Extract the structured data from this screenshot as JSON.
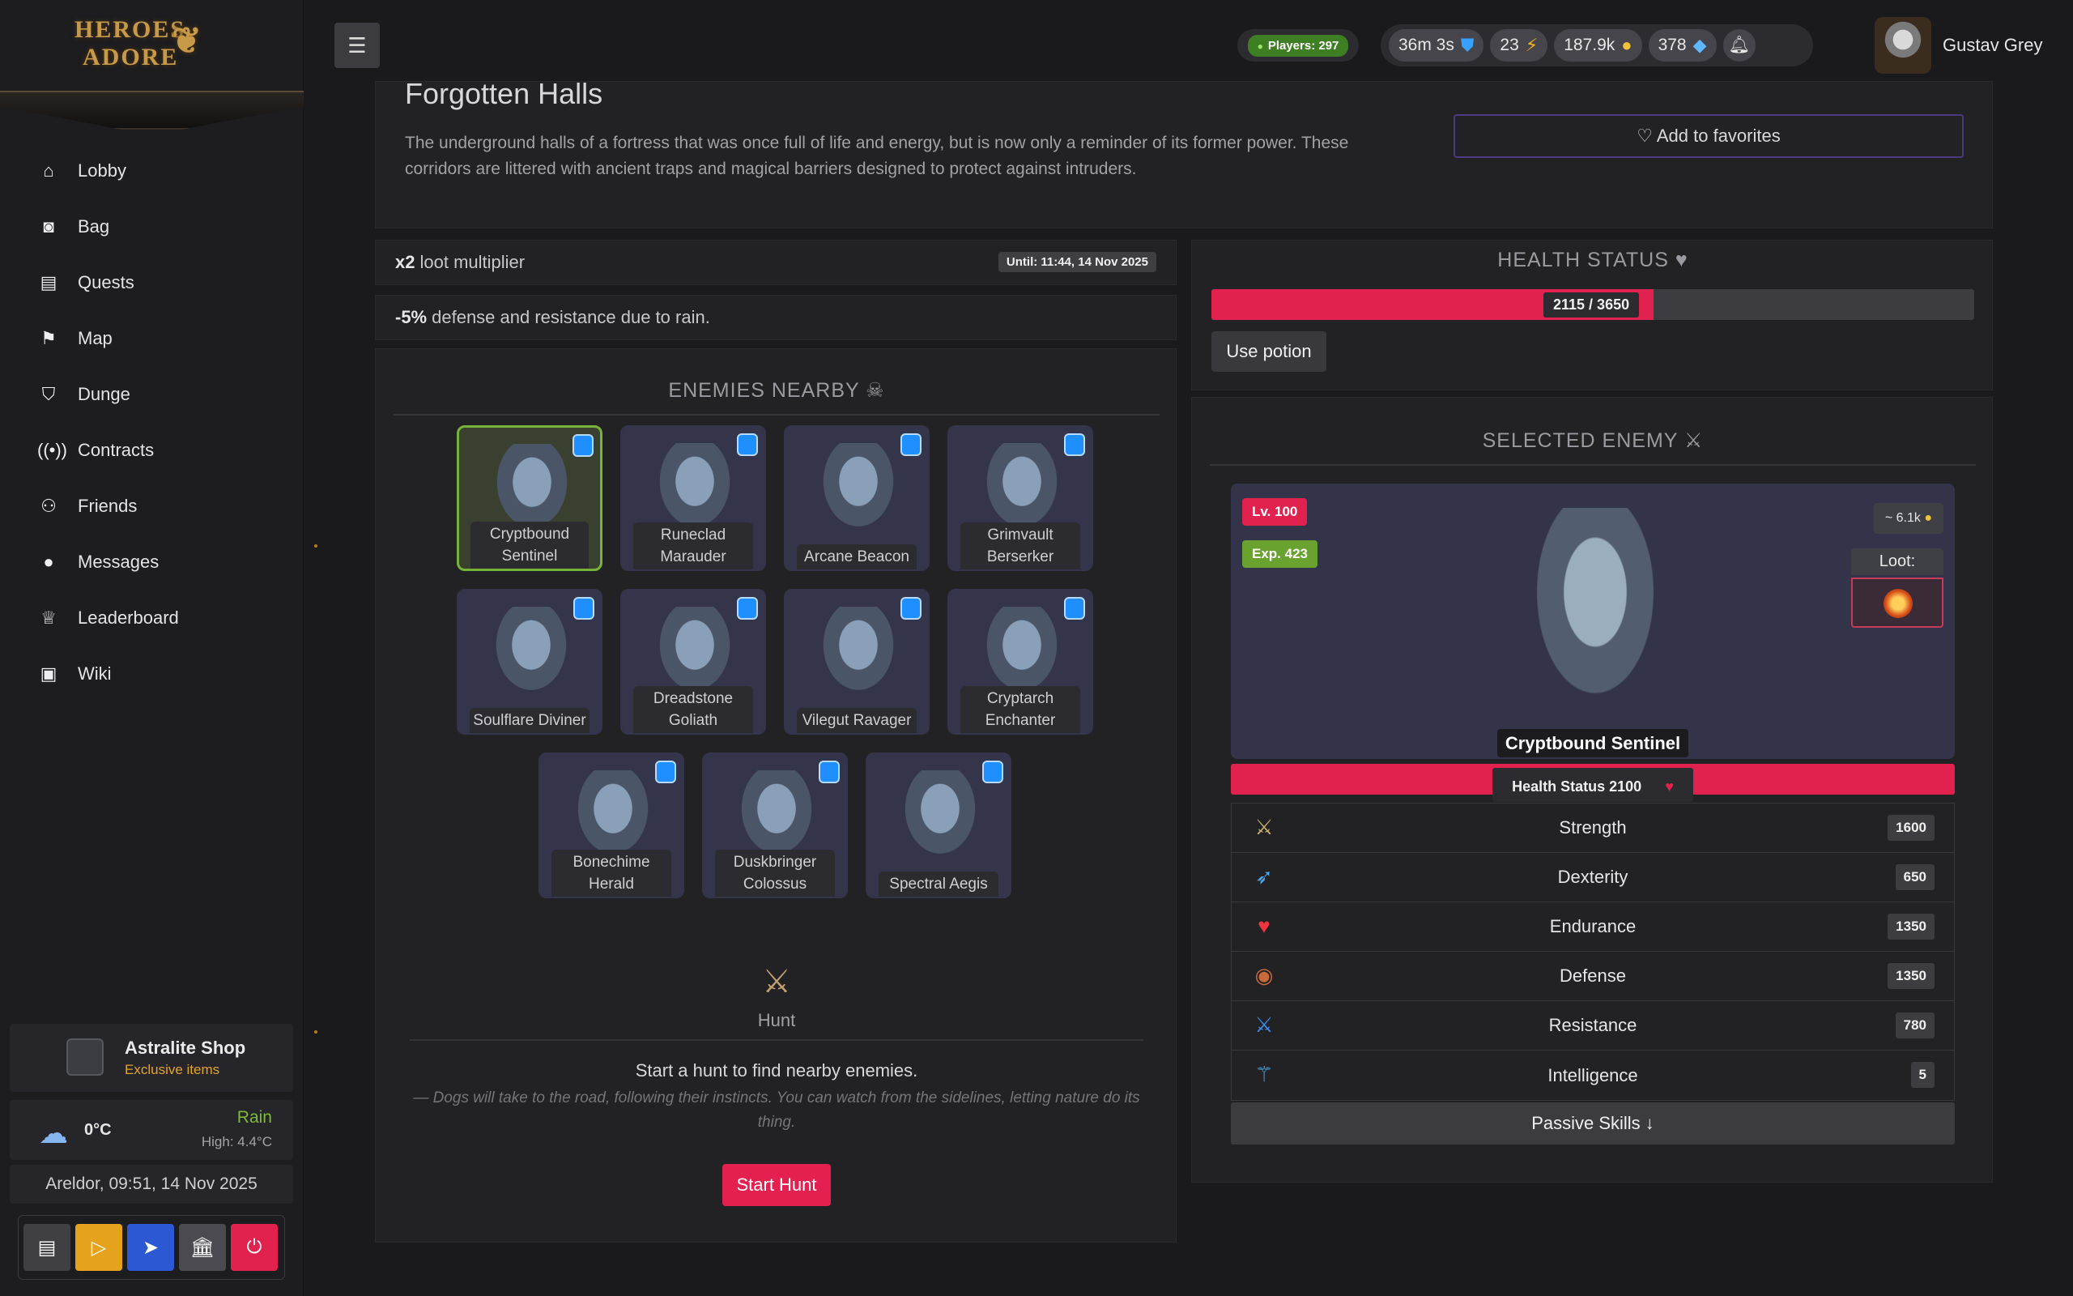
{
  "app": {
    "logo_text_1": "HEROES",
    "logo_text_2": "ADORE",
    "accent": "#e2224e"
  },
  "sidebar": {
    "items": [
      {
        "label": "Lobby",
        "icon": "home-icon"
      },
      {
        "label": "Bag",
        "icon": "bag-icon"
      },
      {
        "label": "Quests",
        "icon": "book-icon"
      },
      {
        "label": "Map",
        "icon": "signpost-icon"
      },
      {
        "label": "Dunge",
        "icon": "shield-icon"
      },
      {
        "label": "Contracts",
        "icon": "broadcast-icon"
      },
      {
        "label": "Friends",
        "icon": "people-icon"
      },
      {
        "label": "Messages",
        "icon": "chat-icon"
      },
      {
        "label": "Leaderboard",
        "icon": "trophy-icon"
      },
      {
        "label": "Wiki",
        "icon": "wiki-icon"
      }
    ],
    "shop": {
      "title": "Astralite Shop",
      "subtitle": "Exclusive items"
    },
    "weather": {
      "temp": "0°C",
      "condition": "Rain",
      "high": "High: 4.4°C"
    },
    "clock": "Areldor, 09:51, 14 Nov 2025",
    "quickbar": [
      {
        "icon": "news-icon",
        "color": "#3f3f44"
      },
      {
        "icon": "play-icon",
        "color": "#e5a21b"
      },
      {
        "icon": "send-icon",
        "color": "#2d58d4"
      },
      {
        "icon": "bank-icon",
        "color": "#4a4a50"
      },
      {
        "icon": "power-icon",
        "color": "#e2224e"
      }
    ]
  },
  "topbar": {
    "players": "Players: 297",
    "timer": "36m 3s",
    "energy": "23",
    "gold": "187.9k",
    "gems": "378",
    "username": "Gustav Grey"
  },
  "location": {
    "title": "Forgotten Halls",
    "description": "The underground halls of a fortress that was once full of life and energy, but is now only a reminder of its former power. These corridors are littered with ancient traps and magical barriers designed to protect against intruders.",
    "favorite_label": "♡ Add to favorites"
  },
  "buffs": {
    "loot_strong": "x2",
    "loot_text": "loot multiplier",
    "until": "Until: 11:44, 14 Nov 2025",
    "rain_strong": "-5%",
    "rain_text": "defense and resistance due to rain."
  },
  "enemies_nearby": {
    "title": "ENEMIES NEARBY",
    "list": [
      "Cryptbound Sentinel",
      "Runeclad Marauder",
      "Arcane Beacon",
      "Grimvault Berserker",
      "Soulflare Diviner",
      "Dreadstone Goliath",
      "Vilegut Ravager",
      "Cryptarch Enchanter",
      "Bonechime Herald",
      "Duskbringer Colossus",
      "Spectral Aegis"
    ],
    "selected_index": 0
  },
  "hunt": {
    "label": "Hunt",
    "text": "Start a hunt to find nearby enemies.",
    "quote": "— Dogs will take to the road, following their instincts. You can watch from the sidelines, letting nature do its thing.",
    "button": "Start Hunt"
  },
  "health": {
    "title": "HEALTH STATUS",
    "current": 2115,
    "max": 3650,
    "text": "2115 / 3650",
    "potion_button": "Use potion"
  },
  "selected_enemy": {
    "title": "SELECTED ENEMY",
    "name": "Cryptbound Sentinel",
    "level": "Lv. 100",
    "exp": "Exp. 423",
    "gold_estimate": "~ 6.1k",
    "loot_label": "Loot:",
    "health_text": "Health Status 2100",
    "stats": [
      {
        "name": "Strength",
        "value": "1600",
        "icon": "crossed-swords-icon"
      },
      {
        "name": "Dexterity",
        "value": "650",
        "icon": "boot-icon"
      },
      {
        "name": "Endurance",
        "value": "1350",
        "icon": "heart-icon"
      },
      {
        "name": "Defense",
        "value": "1350",
        "icon": "round-shield-icon"
      },
      {
        "name": "Resistance",
        "value": "780",
        "icon": "blue-swords-icon"
      },
      {
        "name": "Intelligence",
        "value": "5",
        "icon": "wand-icon"
      }
    ],
    "passive_button": "Passive Skills ↓"
  }
}
